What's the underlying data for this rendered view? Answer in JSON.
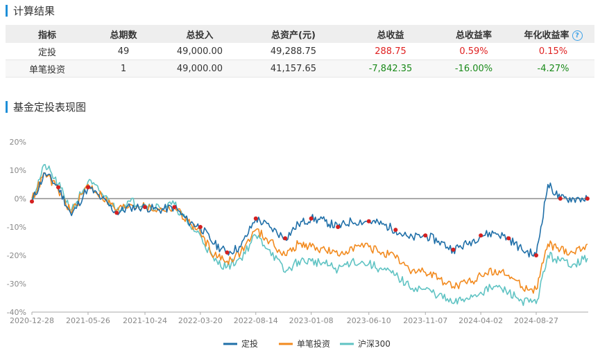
{
  "section1": {
    "title": "计算结果"
  },
  "table": {
    "headers": [
      "指标",
      "总期数",
      "总投入",
      "总资产(元)",
      "总收益",
      "总收益率",
      "年化收益率"
    ],
    "rows": [
      {
        "name": "定投",
        "periods": "49",
        "invest": "49,000.00",
        "assets": "49,288.75",
        "profit": "288.75",
        "rate": "0.59%",
        "annual": "0.15%",
        "sign": "pos"
      },
      {
        "name": "单笔投资",
        "periods": "1",
        "invest": "49,000.00",
        "assets": "41,157.65",
        "profit": "-7,842.35",
        "rate": "-16.00%",
        "annual": "-4.27%",
        "sign": "neg"
      }
    ],
    "help_icon": "question-circle-icon"
  },
  "section2": {
    "title": "基金定投表现图"
  },
  "colors": {
    "accent": "#1e8fd8",
    "dingtou": "#1f6fa8",
    "danbi": "#f28a1e",
    "hs300": "#5fc3c3",
    "marker": "#d42020"
  },
  "chart_data": {
    "type": "line",
    "title": "",
    "xlabel": "",
    "ylabel": "",
    "x_ticks": [
      "2020-12-28",
      "2021-05-26",
      "2021-10-24",
      "2022-03-20",
      "2022-08-14",
      "2023-01-08",
      "2023-06-10",
      "2023-11-07",
      "2024-04-02",
      "2024-08-27"
    ],
    "y_ticks": [
      "20%",
      "10%",
      "0%",
      "-10%",
      "-20%",
      "-30%",
      "-40%"
    ],
    "ylim": [
      -40,
      20
    ],
    "grid": false,
    "legend_position": "bottom",
    "x": [
      "2020-12-28",
      "2021-02-01",
      "2021-03-08",
      "2021-04-12",
      "2021-05-26",
      "2021-07-01",
      "2021-08-10",
      "2021-09-15",
      "2021-10-24",
      "2021-12-01",
      "2022-01-10",
      "2022-02-15",
      "2022-03-20",
      "2022-04-26",
      "2022-05-30",
      "2022-07-05",
      "2022-08-14",
      "2022-09-20",
      "2022-10-31",
      "2022-12-05",
      "2023-01-08",
      "2023-02-14",
      "2023-03-20",
      "2023-04-25",
      "2023-06-10",
      "2023-07-15",
      "2023-08-20",
      "2023-09-25",
      "2023-11-07",
      "2023-12-12",
      "2024-01-20",
      "2024-02-25",
      "2024-04-02",
      "2024-05-10",
      "2024-06-15",
      "2024-07-20",
      "2024-08-27",
      "2024-09-27",
      "2024-10-30",
      "2024-12-05",
      "2025-01-10"
    ],
    "series": [
      {
        "name": "定投",
        "values": [
          -1,
          9,
          4,
          -6,
          4,
          0,
          -5,
          -3,
          -3,
          -4,
          -3,
          -8,
          -10,
          -16,
          -19,
          -17,
          -7,
          -10,
          -14,
          -9,
          -7,
          -8,
          -10,
          -8,
          -8,
          -9,
          -11,
          -14,
          -13,
          -15,
          -18,
          -16,
          -13,
          -12,
          -14,
          -18,
          -20,
          5,
          0,
          0,
          0
        ]
      },
      {
        "name": "单笔投资",
        "values": [
          0,
          9,
          3,
          -5,
          5,
          1,
          -4,
          -2,
          -3,
          -4,
          -3,
          -8,
          -12,
          -20,
          -22,
          -19,
          -11,
          -15,
          -20,
          -16,
          -17,
          -18,
          -20,
          -17,
          -17,
          -19,
          -21,
          -25,
          -26,
          -28,
          -31,
          -30,
          -27,
          -25,
          -27,
          -31,
          -32,
          -16,
          -18,
          -19,
          -16
        ]
      },
      {
        "name": "沪深300",
        "values": [
          0,
          12,
          5,
          -4,
          6,
          2,
          -4,
          -1,
          -2,
          -3,
          -2,
          -9,
          -13,
          -22,
          -24,
          -21,
          -13,
          -18,
          -26,
          -22,
          -22,
          -23,
          -25,
          -22,
          -23,
          -25,
          -27,
          -31,
          -32,
          -34,
          -37,
          -35,
          -33,
          -31,
          -33,
          -36,
          -37,
          -20,
          -22,
          -23,
          -21
        ]
      }
    ],
    "investment_markers": "red dots on 定投 line"
  },
  "legend": {
    "items": [
      "定投",
      "单笔投资",
      "沪深300"
    ]
  }
}
